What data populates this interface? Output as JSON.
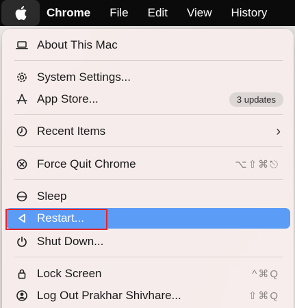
{
  "menubar": {
    "apple_icon": "apple-logo-icon",
    "items": [
      {
        "label": "Chrome"
      },
      {
        "label": "File"
      },
      {
        "label": "Edit"
      },
      {
        "label": "View"
      },
      {
        "label": "History"
      }
    ]
  },
  "menu": {
    "about": {
      "label": "About This Mac",
      "icon": "laptop-icon"
    },
    "settings": {
      "label": "System Settings...",
      "icon": "gear-icon"
    },
    "appstore": {
      "label": "App Store...",
      "icon": "app-store-icon",
      "badge": "3 updates"
    },
    "recent": {
      "label": "Recent Items",
      "icon": "clock-icon"
    },
    "forcequit": {
      "label": "Force Quit Chrome",
      "icon": "force-quit-icon",
      "shortcut": "⌥⇧⌘⎋"
    },
    "sleep": {
      "label": "Sleep",
      "icon": "sleep-icon"
    },
    "restart": {
      "label": "Restart...",
      "icon": "restart-icon"
    },
    "shutdown": {
      "label": "Shut Down...",
      "icon": "power-icon"
    },
    "lock": {
      "label": "Lock Screen",
      "icon": "lock-icon",
      "shortcut": "^⌘Q"
    },
    "logout": {
      "label": "Log Out Prakhar Shivhare...",
      "icon": "user-icon",
      "shortcut": "⇧⌘Q"
    }
  },
  "colors": {
    "highlight": "#5b9cf6",
    "annotation_box": "#e5242b"
  }
}
